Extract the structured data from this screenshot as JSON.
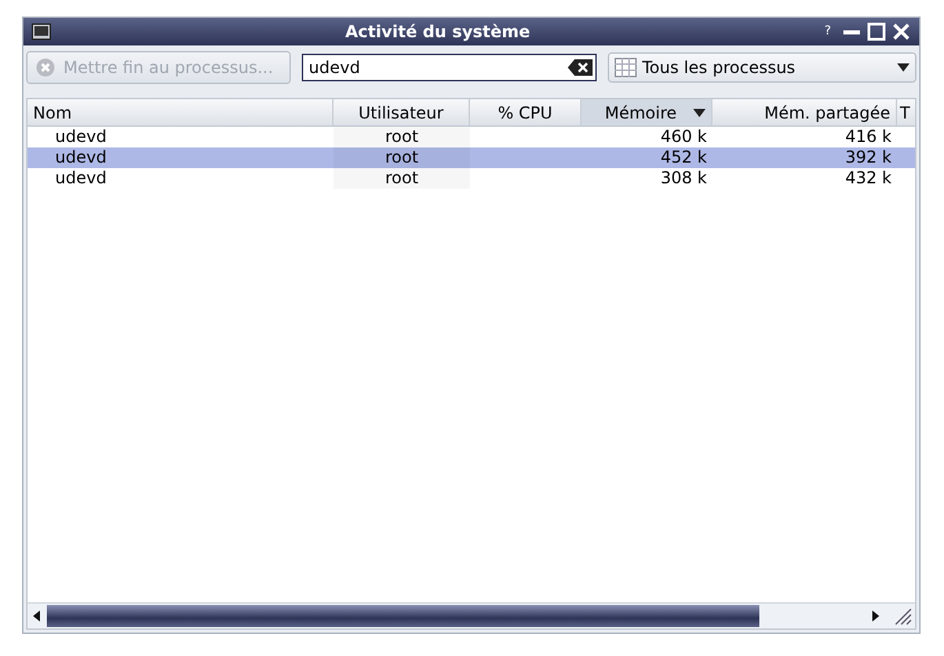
{
  "window": {
    "title": "Activité du système",
    "help": "?"
  },
  "toolbar": {
    "end_button": {
      "label": "Mettre fin au processus...",
      "disabled": true
    },
    "search": {
      "value": "udevd"
    },
    "filter": {
      "value": "Tous les processus"
    }
  },
  "table": {
    "columns": [
      {
        "label": "Nom",
        "sorted": false
      },
      {
        "label": "Utilisateur",
        "sorted": false
      },
      {
        "label": "% CPU",
        "sorted": false
      },
      {
        "label": "Mémoire",
        "sorted": true
      },
      {
        "label": "Mém. partagée",
        "sorted": false
      },
      {
        "label": "T",
        "sorted": false
      }
    ],
    "rows": [
      {
        "cells": [
          "udevd",
          "root",
          "",
          "460 k",
          "416 k"
        ],
        "selected": false
      },
      {
        "cells": [
          "udevd",
          "root",
          "",
          "452 k",
          "392 k"
        ],
        "selected": true
      },
      {
        "cells": [
          "udevd",
          "root",
          "",
          "308 k",
          "432 k"
        ],
        "selected": false
      }
    ]
  }
}
